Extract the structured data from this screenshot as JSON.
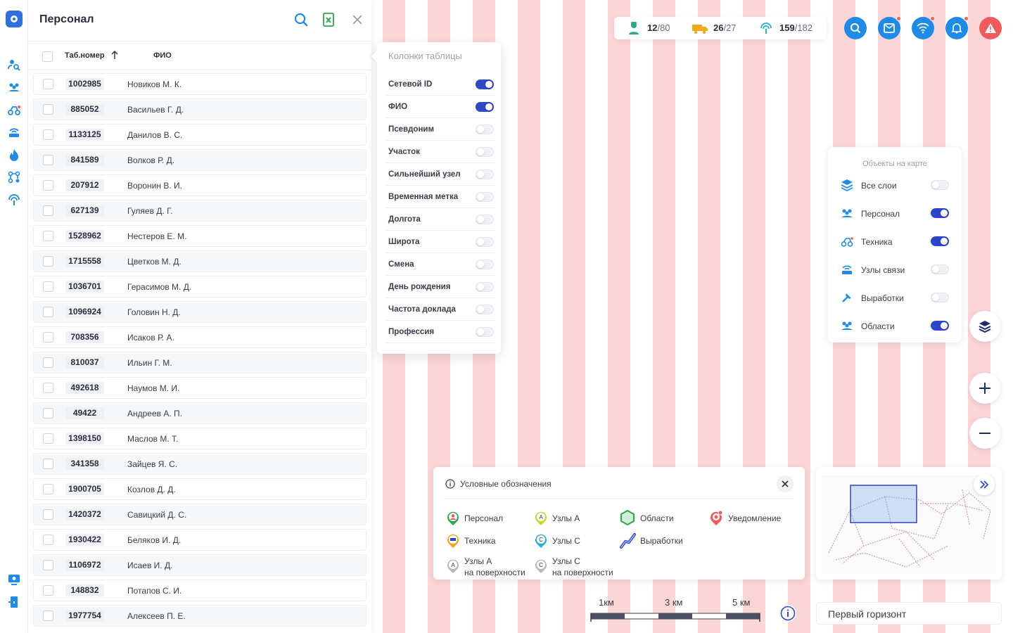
{
  "panel": {
    "title": "Персонал",
    "columns": {
      "tab_number": "Таб.номер",
      "name": "ФИО"
    },
    "rows": [
      {
        "id": "1002985",
        "name": "Новиков М. К."
      },
      {
        "id": "885052",
        "name": "Васильев Г. Д."
      },
      {
        "id": "1133125",
        "name": "Данилов В. С."
      },
      {
        "id": "841589",
        "name": "Волков Р. Д."
      },
      {
        "id": "207912",
        "name": "Воронин В. И."
      },
      {
        "id": "627139",
        "name": "Гуляев Д. Г."
      },
      {
        "id": "1528962",
        "name": "Нестеров Е. М."
      },
      {
        "id": "1715558",
        "name": "Цветков М. Д."
      },
      {
        "id": "1036701",
        "name": "Герасимов М. Д."
      },
      {
        "id": "1096924",
        "name": "Головин Н. Д."
      },
      {
        "id": "708356",
        "name": "Исаков Р. А."
      },
      {
        "id": "810037",
        "name": "Ильин Г. М."
      },
      {
        "id": "492618",
        "name": "Наумов М. И."
      },
      {
        "id": "49422",
        "name": "Андреев А. П."
      },
      {
        "id": "1398150",
        "name": "Маслов М. Т."
      },
      {
        "id": "341358",
        "name": "Зайцев Я. С."
      },
      {
        "id": "1900705",
        "name": "Козлов Д. Д."
      },
      {
        "id": "1420372",
        "name": "Савицкий Д. С."
      },
      {
        "id": "1930422",
        "name": "Беляков И. Д."
      },
      {
        "id": "1106972",
        "name": "Исаев И. Д."
      },
      {
        "id": "148832",
        "name": "Потапов С. И."
      },
      {
        "id": "1977754",
        "name": "Алексеев П. Е."
      }
    ]
  },
  "columns_popup": {
    "title": "Колонки таблицы",
    "items": [
      {
        "label": "Сетевой ID",
        "on": true
      },
      {
        "label": "ФИО",
        "on": true
      },
      {
        "label": "Псевдоним",
        "on": false
      },
      {
        "label": "Участок",
        "on": false
      },
      {
        "label": "Сильнейший узел",
        "on": false
      },
      {
        "label": "Временная метка",
        "on": false
      },
      {
        "label": "Долгота",
        "on": false
      },
      {
        "label": "Широта",
        "on": false
      },
      {
        "label": "Смена",
        "on": false
      },
      {
        "label": "День рождения",
        "on": false
      },
      {
        "label": "Частота доклада",
        "on": false
      },
      {
        "label": "Профессия",
        "on": false
      }
    ]
  },
  "stats": {
    "personnel": {
      "current": "12",
      "total": "/80"
    },
    "vehicles": {
      "current": "26",
      "total": "/27"
    },
    "nodes": {
      "current": "159",
      "total": "/182"
    }
  },
  "layers": {
    "title": "Объекты на карте",
    "items": [
      {
        "label": "Все слои",
        "on": false,
        "icon": "layers-icon"
      },
      {
        "label": "Персонал",
        "on": true,
        "icon": "people-icon"
      },
      {
        "label": "Техника",
        "on": true,
        "icon": "vehicle-icon"
      },
      {
        "label": "Узлы связи",
        "on": false,
        "icon": "router-icon"
      },
      {
        "label": "Выработки",
        "on": false,
        "icon": "mining-icon"
      },
      {
        "label": "Области",
        "on": true,
        "icon": "people-icon"
      }
    ]
  },
  "legend": {
    "title": "Условные обозначения",
    "personnel": "Персонал",
    "nodes_a": "Узлы А",
    "areas": "Области",
    "notification": "Уведомление",
    "vehicles": "Техника",
    "nodes_c": "Узлы С",
    "workings": "Выработки",
    "nodes_a_surface_1": "Узлы А",
    "nodes_a_surface_2": "на поверхности",
    "nodes_c_surface_1": "Узлы С",
    "nodes_c_surface_2": "на поверхности"
  },
  "scale": {
    "s1": "1км",
    "s3": "3 км",
    "s5": "5 км"
  },
  "horizon": "Первый горизонт",
  "colors": {
    "accent": "#2c46c9",
    "brand": "#2f6fe0",
    "button_blue": "#1f8be8",
    "alert_red": "#f05a5a",
    "stripe": "#fcd6d6"
  }
}
